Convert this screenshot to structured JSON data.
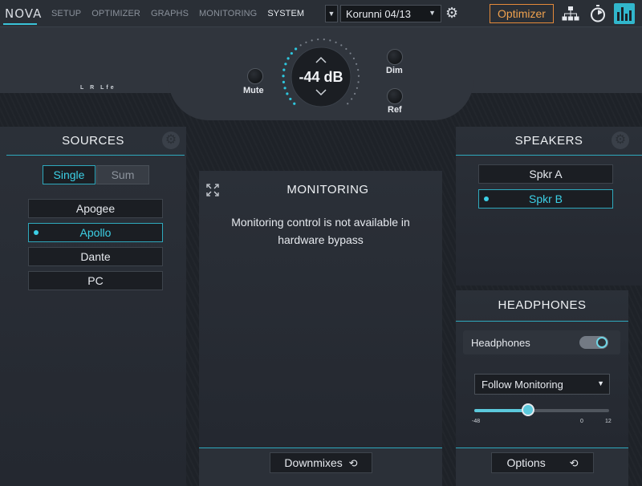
{
  "app": {
    "logo": "NOVA"
  },
  "nav": {
    "items": [
      {
        "label": "SETUP",
        "active": false
      },
      {
        "label": "OPTIMIZER",
        "active": false
      },
      {
        "label": "GRAPHS",
        "active": false
      },
      {
        "label": "MONITORING",
        "active": false
      },
      {
        "label": "SYSTEM",
        "active": true
      }
    ]
  },
  "preset": {
    "value": "Korunni 04/13"
  },
  "toolbar": {
    "optimizer_label": "Optimizer"
  },
  "header": {
    "meter_label": "L R Lfe",
    "mute_label": "Mute",
    "dim_label": "Dim",
    "ref_label": "Ref",
    "volume": "-44 dB"
  },
  "sources": {
    "title": "SOURCES",
    "mode_single": "Single",
    "mode_sum": "Sum",
    "items": [
      {
        "label": "Apogee",
        "selected": false
      },
      {
        "label": "Apollo",
        "selected": true
      },
      {
        "label": "Dante",
        "selected": false
      },
      {
        "label": "PC",
        "selected": false
      }
    ]
  },
  "monitoring": {
    "title": "MONITORING",
    "message_line1": "Monitoring control is not available in",
    "message_line2": "hardware bypass",
    "downmixes_label": "Downmixes"
  },
  "speakers": {
    "title": "SPEAKERS",
    "items": [
      {
        "label": "Spkr A",
        "selected": false
      },
      {
        "label": "Spkr B",
        "selected": true
      }
    ]
  },
  "headphones": {
    "title": "HEADPHONES",
    "toggle_label": "Headphones",
    "toggle_on": true,
    "follow_select": "Follow Monitoring",
    "slider_min": "-48",
    "slider_mid": "0",
    "slider_max": "12",
    "slider_value_fraction": 0.4,
    "options_label": "Options"
  },
  "colors": {
    "accent": "#2ea9bd",
    "optimizer": "#f0a24f"
  }
}
